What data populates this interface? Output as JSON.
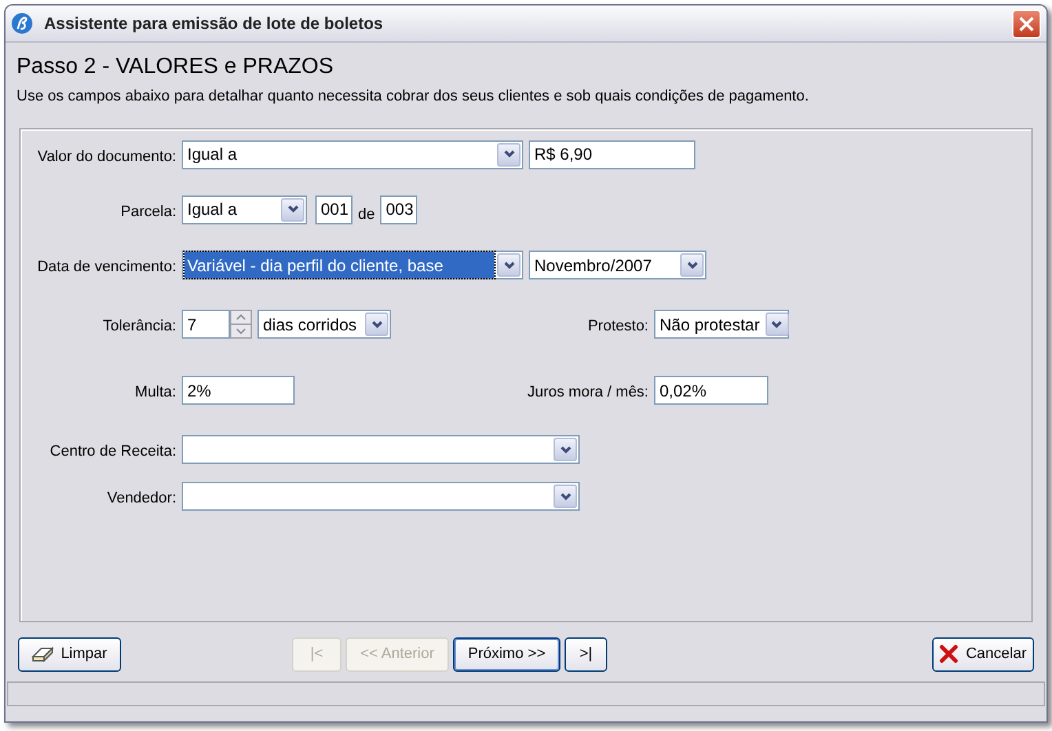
{
  "window": {
    "title": "Assistente para emissão de lote de boletos"
  },
  "header": {
    "title": "Passo 2 - VALORES e PRAZOS",
    "description": "Use os campos abaixo para detalhar quanto necessita cobrar dos seus clientes e sob quais condições de pagamento."
  },
  "valor": {
    "label": "Valor do documento:",
    "mode": {
      "value": "Igual a",
      "focused": false
    },
    "amount": {
      "value": "R$ 6,90"
    }
  },
  "parcela": {
    "label": "Parcela:",
    "mode": {
      "value": "Igual a",
      "focused": false
    },
    "from": {
      "value": "001"
    },
    "separator": "de",
    "to": {
      "value": "003"
    }
  },
  "vencimento": {
    "label": "Data de vencimento:",
    "mode": {
      "value": "Variável - dia perfil do cliente, base",
      "focused": true
    },
    "month": {
      "value": "Novembro/2007",
      "focused": false
    }
  },
  "tolerancia": {
    "label": "Tolerância:",
    "days": {
      "value": "7"
    },
    "unit": {
      "value": "dias corridos",
      "focused": false
    }
  },
  "protesto": {
    "label": "Protesto:",
    "option": {
      "value": "Não protestar",
      "focused": false
    }
  },
  "multa": {
    "label": "Multa:",
    "value": "2%"
  },
  "juros": {
    "label": "Juros mora / mês:",
    "value": "0,02%"
  },
  "centro": {
    "label": "Centro de Receita:",
    "value": {
      "focused": false
    }
  },
  "vendedor": {
    "label": "Vendedor:",
    "value": {
      "focused": false
    }
  },
  "buttons": [
    {
      "kind": "clear",
      "label": "Limpar",
      "disabled": false,
      "default": false
    },
    {
      "kind": "first",
      "label": "|<",
      "disabled": true,
      "default": false
    },
    {
      "kind": "prev",
      "label": "<< Anterior",
      "disabled": true,
      "default": false
    },
    {
      "kind": "next",
      "label": "Próximo >>",
      "disabled": false,
      "default": true
    },
    {
      "kind": "last",
      "label": ">|",
      "disabled": false,
      "default": false
    },
    {
      "kind": "cancel",
      "label": "Cancelar",
      "disabled": false,
      "default": false
    }
  ]
}
